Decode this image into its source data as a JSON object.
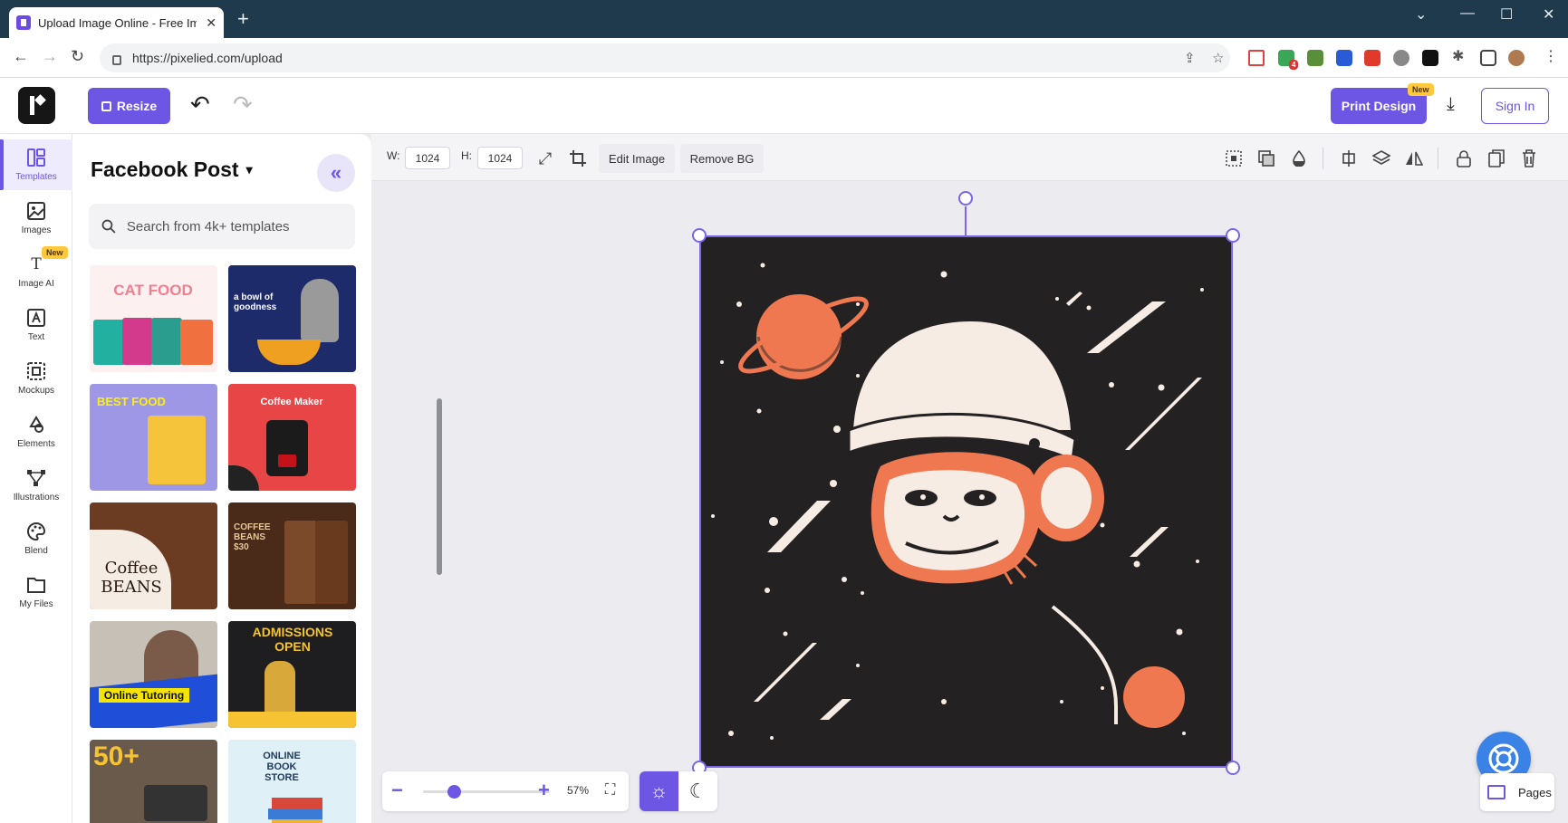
{
  "browser": {
    "tab_title": "Upload Image Online - Free Imag",
    "url": "https://pixelied.com/upload",
    "ext_badge": "4"
  },
  "header": {
    "resize_label": "Resize",
    "print_label": "Print Design",
    "print_badge": "New",
    "signin_label": "Sign In"
  },
  "rail": {
    "items": [
      {
        "label": "Templates"
      },
      {
        "label": "Images"
      },
      {
        "label": "Image AI",
        "badge": "New"
      },
      {
        "label": "Text"
      },
      {
        "label": "Mockups"
      },
      {
        "label": "Elements"
      },
      {
        "label": "Illustrations"
      },
      {
        "label": "Blend"
      },
      {
        "label": "My Files"
      }
    ]
  },
  "panel": {
    "title": "Facebook Post",
    "search_placeholder": "Search from 4k+ templates",
    "thumbs": [
      {
        "text": "CAT FOOD"
      },
      {
        "text": "a bowl of goodness"
      },
      {
        "text": "BEST FOOD"
      },
      {
        "text": "Coffee Maker"
      },
      {
        "text": "Coffee BEANS"
      },
      {
        "text": "COFFEE BEANS $30"
      },
      {
        "text": "Online Tutoring"
      },
      {
        "text": "ADMISSIONS OPEN"
      },
      {
        "text": "50+"
      },
      {
        "text": "ONLINE BOOK STORE"
      }
    ]
  },
  "canvas_toolbar": {
    "w_label": "W:",
    "w_value": "1024",
    "h_label": "H:",
    "h_value": "1024",
    "edit_image": "Edit Image",
    "remove_bg": "Remove BG"
  },
  "zoom": {
    "percent": "57%",
    "level": 0.57
  },
  "pages_label": "Pages",
  "colors": {
    "accent": "#6c56e3",
    "artwork_bg": "#232122",
    "orange": "#f07850",
    "cream": "#f7ece4"
  }
}
